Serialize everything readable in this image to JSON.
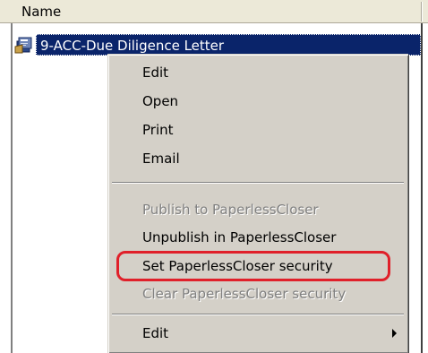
{
  "header": {
    "name_label": "Name"
  },
  "file": {
    "name": "9-ACC-Due Diligence Letter",
    "icon": "document-package-icon"
  },
  "context_menu": {
    "items": [
      {
        "label": "Edit",
        "enabled": true
      },
      {
        "label": "Open",
        "enabled": true
      },
      {
        "label": "Print",
        "enabled": true
      },
      {
        "label": "Email",
        "enabled": true
      },
      {
        "label": "Publish to PaperlessCloser",
        "enabled": false
      },
      {
        "label": "Unpublish in PaperlessCloser",
        "enabled": true
      },
      {
        "label": "Set PaperlessCloser security",
        "enabled": true,
        "highlighted": true
      },
      {
        "label": "Clear PaperlessCloser security",
        "enabled": false
      },
      {
        "label": "Edit",
        "enabled": true,
        "submenu": true
      }
    ]
  },
  "colors": {
    "selection": "#0a246a",
    "menu_background": "#d4d0c8",
    "highlight_outline": "#e0202a",
    "disabled_text": "#808080"
  }
}
